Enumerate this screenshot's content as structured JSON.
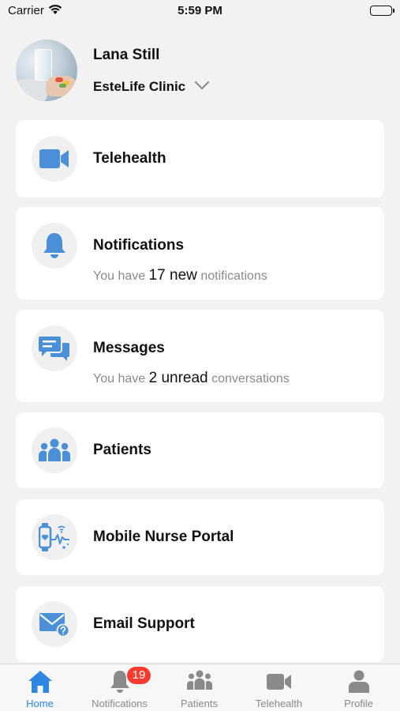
{
  "status_bar": {
    "carrier": "Carrier",
    "time": "5:59 PM"
  },
  "profile": {
    "name": "Lana Still",
    "clinic": "EsteLife Clinic"
  },
  "cards": {
    "telehealth": {
      "title": "Telehealth"
    },
    "notifications": {
      "title": "Notifications",
      "prefix": "You have",
      "count": "17 new",
      "suffix": "notifications"
    },
    "messages": {
      "title": "Messages",
      "prefix": "You have",
      "count": "2 unread",
      "suffix": "conversations"
    },
    "patients": {
      "title": "Patients"
    },
    "nurse": {
      "title": "Mobile Nurse Portal"
    },
    "email": {
      "title": "Email Support"
    }
  },
  "tabs": {
    "home": "Home",
    "notifications": "Notifications",
    "notifications_badge": "19",
    "patients": "Patients",
    "telehealth": "Telehealth",
    "profile": "Profile"
  },
  "colors": {
    "accent": "#2f86e0",
    "icon_blue": "#4a90d9",
    "tab_gray": "#8a8a8a",
    "badge_red": "#ff3b30"
  }
}
